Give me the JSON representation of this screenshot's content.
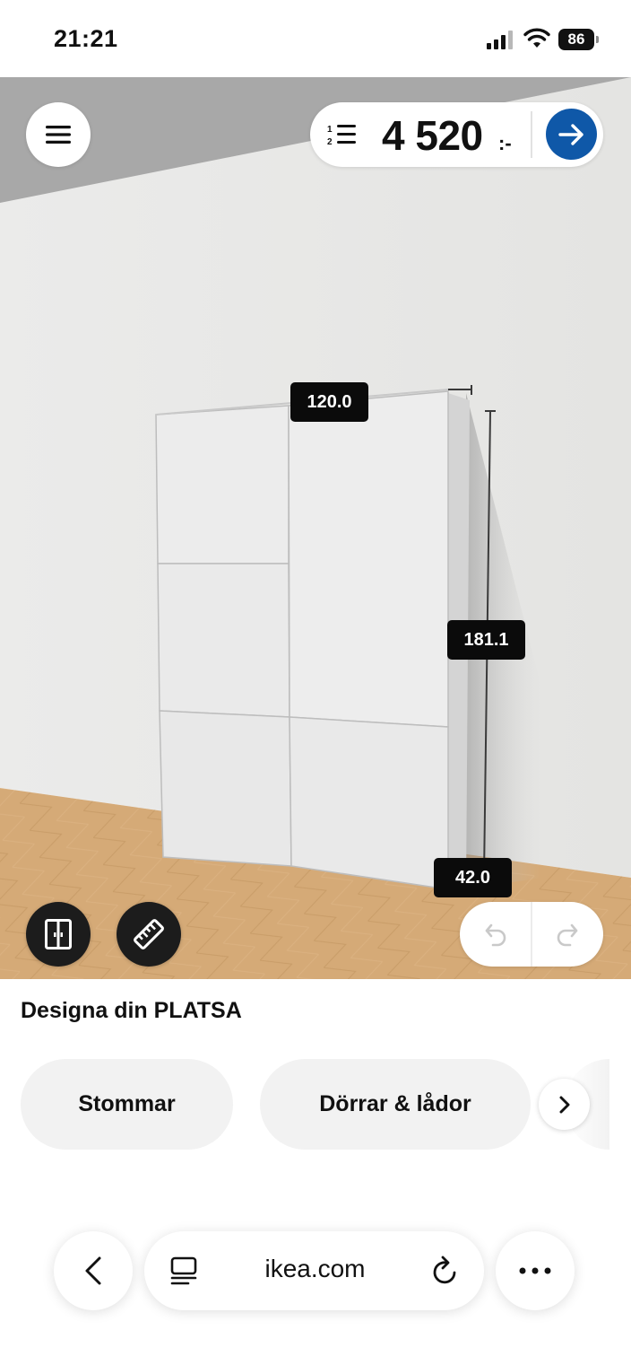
{
  "status_bar": {
    "time": "21:21",
    "battery": "86"
  },
  "header": {
    "price": "4 520",
    "price_suffix": ":-"
  },
  "scene": {
    "dimensions": {
      "width": "120.0",
      "height": "181.1",
      "depth": "42.0"
    },
    "colors": {
      "accent": "#0f58a8",
      "wall": "#e9e9e7",
      "floor": "#ddb078",
      "cabinet": "#ececec"
    }
  },
  "panel": {
    "title": "Designa din PLATSA",
    "chips": [
      {
        "label": "Stommar"
      },
      {
        "label": "Dörrar & lådor"
      }
    ]
  },
  "browser": {
    "url": "ikea.com"
  },
  "icons": {
    "menu": "hamburger-menu-icon",
    "list": "numbered-list-icon",
    "go": "arrow-right-icon",
    "frame": "double-door-icon",
    "measure": "ruler-icon",
    "undo": "undo-icon",
    "redo": "redo-icon",
    "next": "chevron-right-icon",
    "back": "chevron-left-icon",
    "tabs": "tabs-icon",
    "reload": "reload-icon",
    "more": "more-dots-icon"
  }
}
